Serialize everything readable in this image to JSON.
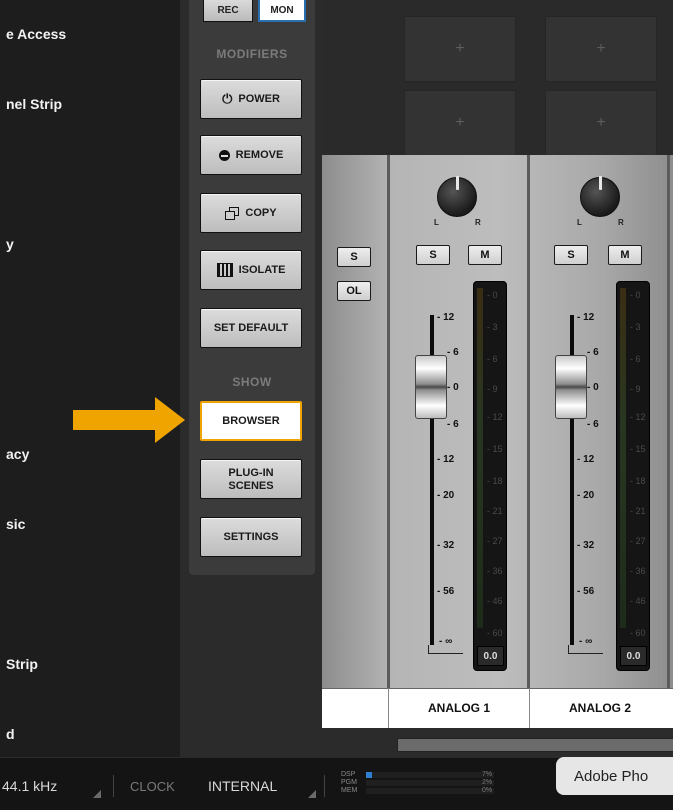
{
  "sidebar": {
    "items": [
      {
        "label": "e Access"
      },
      {
        "label": "nel Strip"
      },
      {
        "label": "y"
      },
      {
        "label": "acy"
      },
      {
        "label": "sic"
      },
      {
        "label": "Strip"
      },
      {
        "label": "d"
      }
    ]
  },
  "top_buttons": {
    "rec": "REC",
    "mon": "MON"
  },
  "modifiers": {
    "heading": "MODIFIERS",
    "power": "POWER",
    "remove": "REMOVE",
    "copy": "COPY",
    "isolate": "ISOLATE",
    "set_default": "SET DEFAULT"
  },
  "show": {
    "heading": "SHOW",
    "browser": "BROWSER",
    "plugin_scenes_line1": "PLUG-IN",
    "plugin_scenes_line2": "SCENES",
    "settings": "SETTINGS"
  },
  "slots": {
    "plus": "+"
  },
  "channels": {
    "left_strip": {
      "solo": "S",
      "overload": "OL"
    },
    "strips": [
      {
        "name": "ANALOG 1",
        "solo": "S",
        "mute": "M",
        "pan_left": "L",
        "pan_right": "R",
        "meter_value": "0.0"
      },
      {
        "name": "ANALOG 2",
        "solo": "S",
        "mute": "M",
        "pan_left": "L",
        "pan_right": "R",
        "meter_value": "0.0"
      }
    ],
    "fader_scale": [
      "12",
      "6",
      "0",
      "6",
      "12",
      "20",
      "32",
      "56",
      "∞"
    ],
    "meter_scale": [
      "0",
      "3",
      "6",
      "9",
      "12",
      "15",
      "18",
      "21",
      "27",
      "36",
      "46",
      "60"
    ]
  },
  "status_bar": {
    "sample_rate": "44.1 kHz",
    "clock_label": "CLOCK",
    "clock_source": "INTERNAL",
    "dsp_label": "DSP",
    "pgm_label": "PGM",
    "mem_label": "MEM",
    "dsp_value": "7%",
    "pgm_value": "2%",
    "mem_value": "0%",
    "dsp_fill": 0.05,
    "app_name": "Adobe Pho"
  },
  "colors": {
    "highlight_arrow": "#f0a400",
    "browser_border": "#f0a400"
  }
}
